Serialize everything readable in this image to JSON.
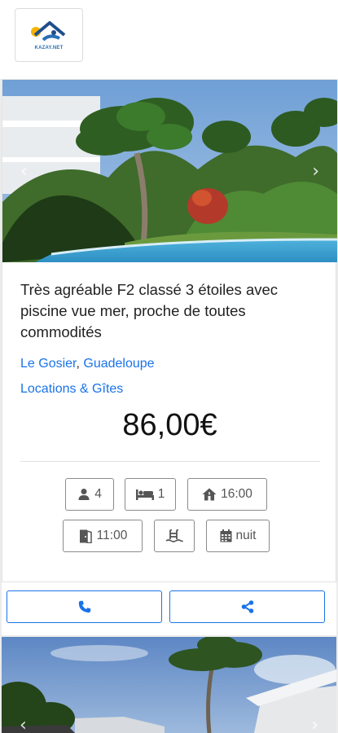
{
  "header": {
    "logo_text": "KAZAY.NET"
  },
  "listing": {
    "photo_description": "pool-garden-photo",
    "prev_arrow": "‹",
    "next_arrow": "›",
    "title": "Très agréable F2 classé 3 étoiles avec piscine vue mer, proche de toutes commodités",
    "city": "Le Gosier",
    "separator": ",",
    "region": "Guadeloupe",
    "category": "Locations & Gîtes",
    "price": "86,00€",
    "chips": {
      "guests": "4",
      "bedrooms": "1",
      "checkin": "16:00",
      "checkout": "11:00",
      "rate_unit": "nuit"
    },
    "icons": {
      "guests": "user-icon",
      "bedrooms": "bed-icon",
      "checkin": "house-icon",
      "checkout": "door-icon",
      "pool": "pool-icon",
      "rate": "calendar-icon",
      "call": "phone-icon",
      "share": "share-icon"
    }
  },
  "next_listing": {
    "prev_arrow": "‹",
    "next_arrow": "›"
  },
  "colors": {
    "accent": "#1a73e8",
    "chip_border": "#8b8b8b",
    "text": "#222222"
  }
}
